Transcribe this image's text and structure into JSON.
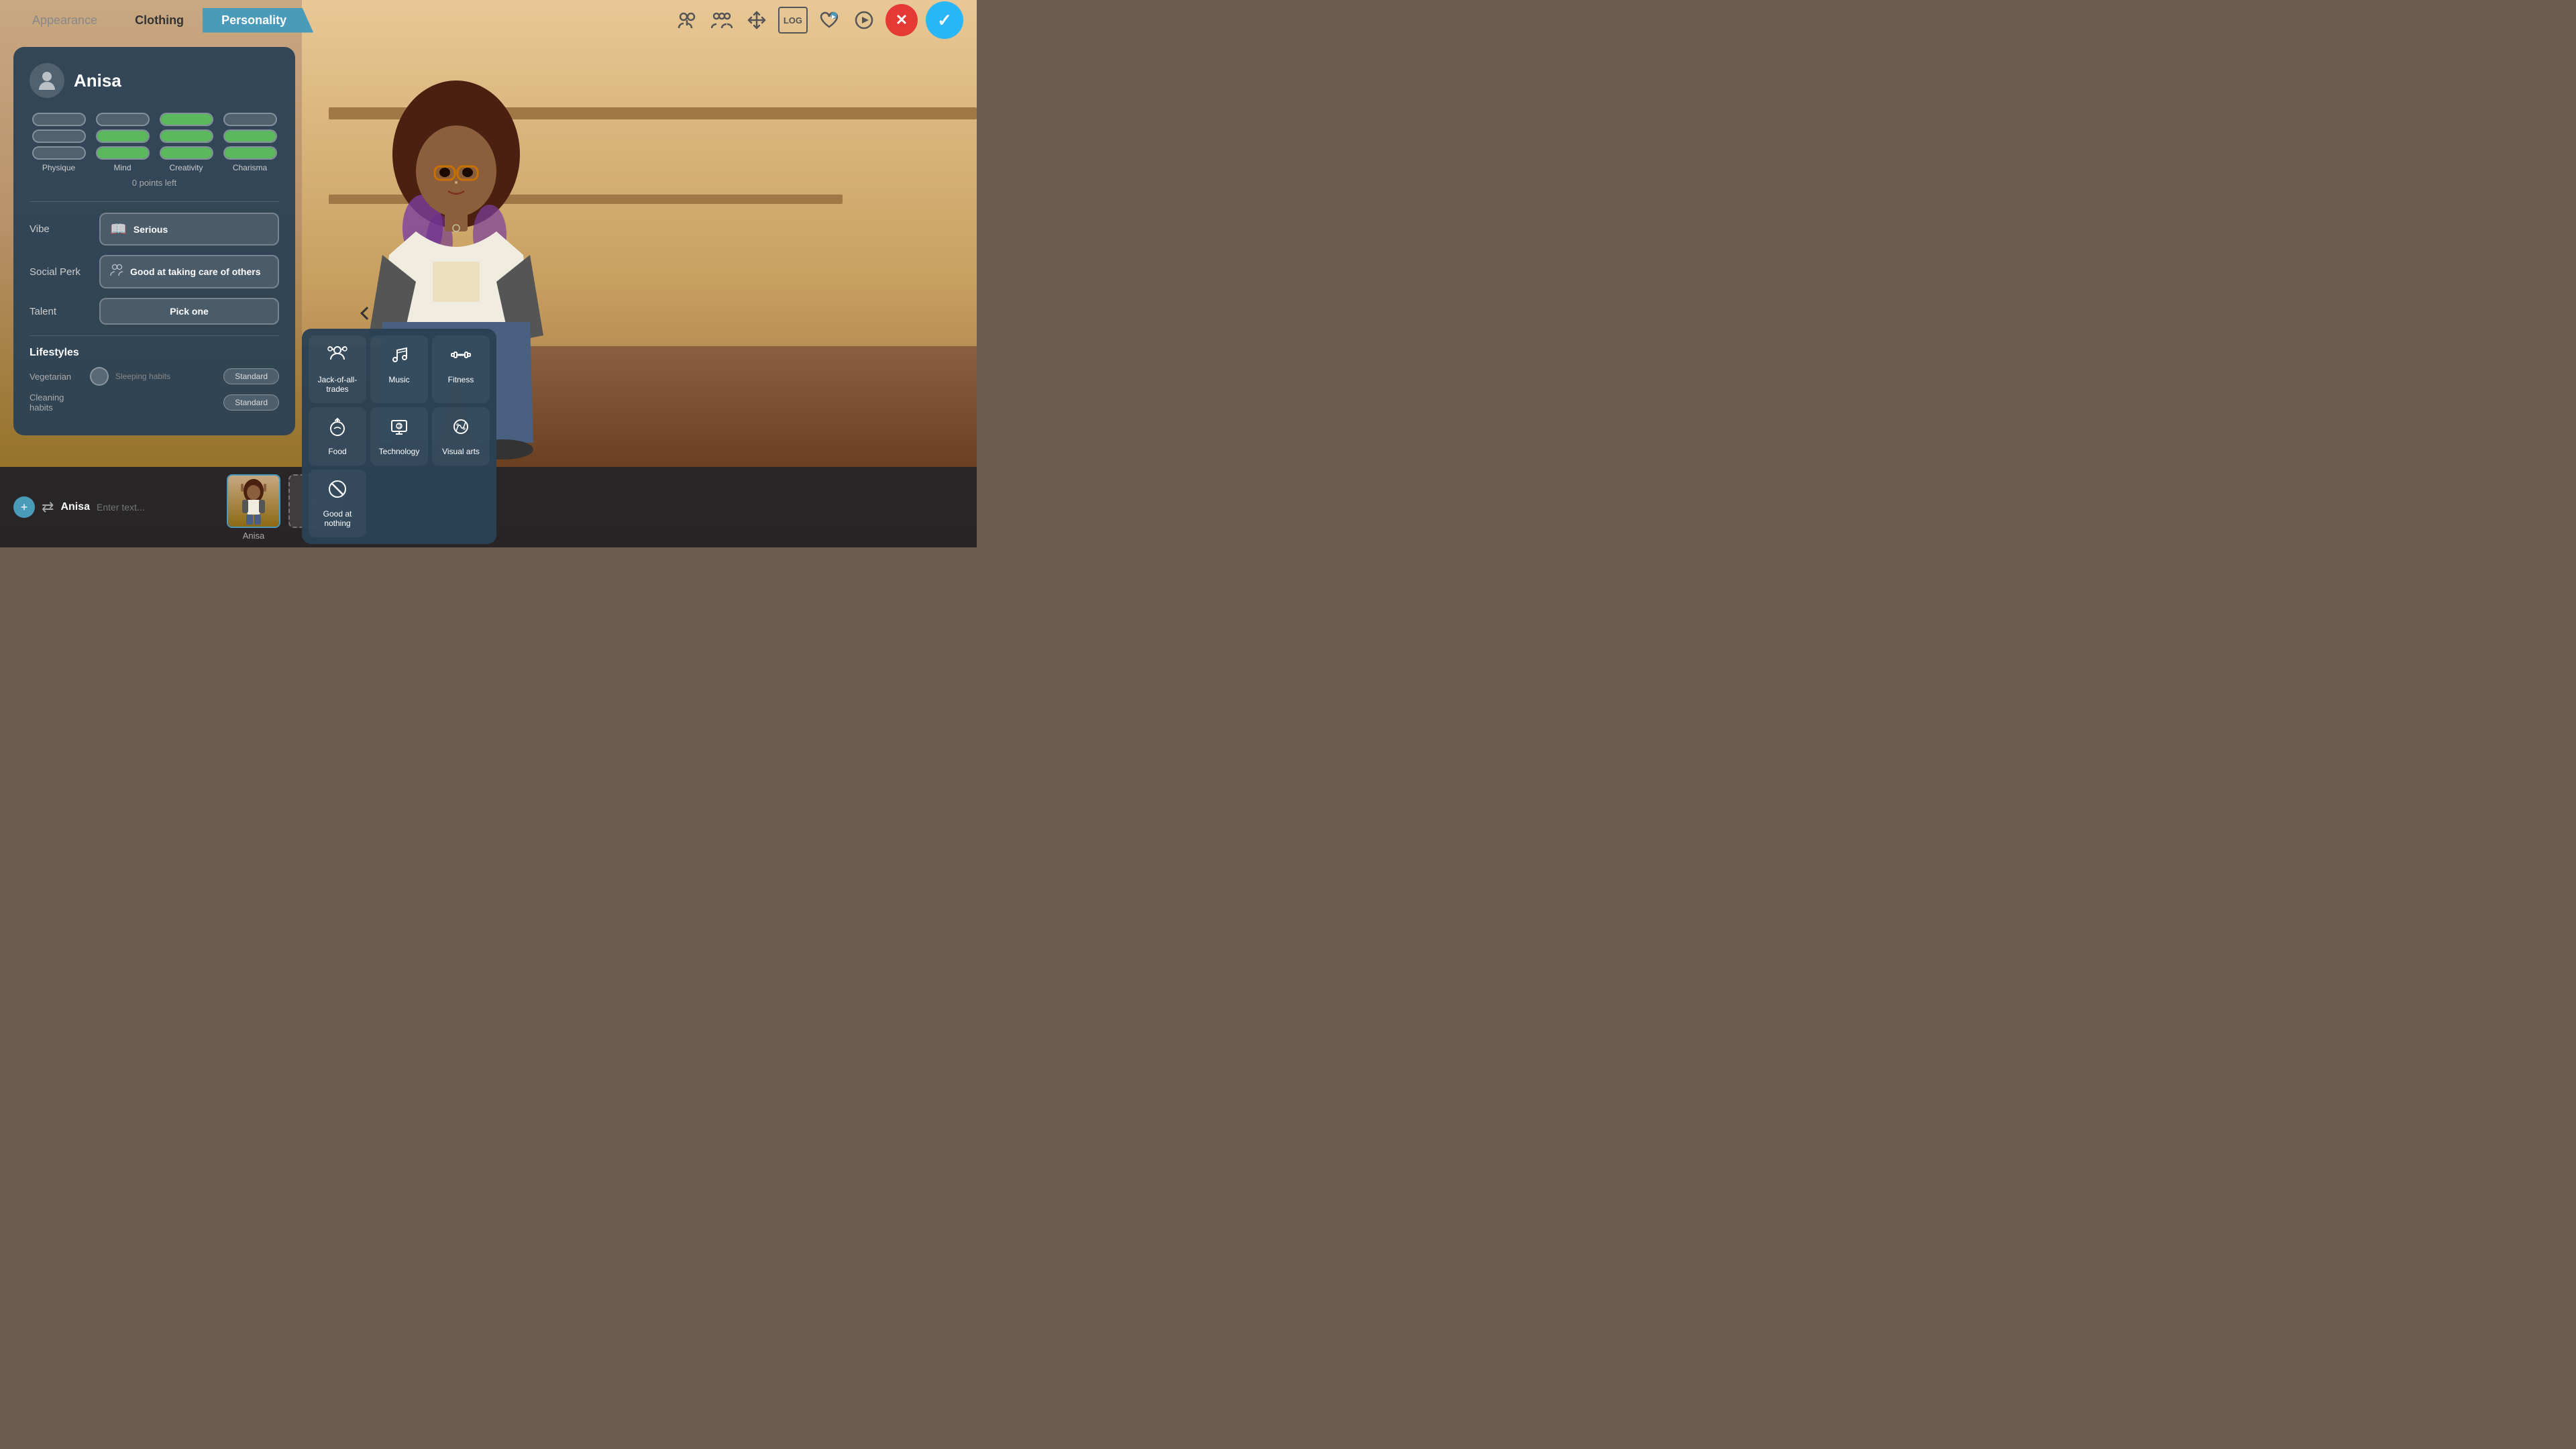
{
  "nav": {
    "tabs": [
      {
        "id": "appearance",
        "label": "Appearance",
        "active": false
      },
      {
        "id": "clothing",
        "label": "Clothing",
        "active": false
      },
      {
        "id": "personality",
        "label": "Personality",
        "active": true
      }
    ],
    "icons": [
      {
        "id": "relationships",
        "symbol": "👥",
        "label": "Relationships"
      },
      {
        "id": "group",
        "symbol": "👨‍👩‍👧‍👦",
        "label": "Group"
      },
      {
        "id": "arrow",
        "symbol": "🔀",
        "label": "Move"
      },
      {
        "id": "log",
        "label": "LOG"
      },
      {
        "id": "heart",
        "symbol": "❤️",
        "label": "Heart"
      },
      {
        "id": "play",
        "symbol": "▶",
        "label": "Play"
      }
    ],
    "cancel_label": "✕",
    "confirm_label": "✓"
  },
  "panel": {
    "character_name": "Anisa",
    "stats": {
      "points_left": "0 points left",
      "columns": [
        {
          "label": "Physique",
          "bars": [
            {
              "fill": "empty"
            },
            {
              "fill": "empty"
            },
            {
              "fill": "empty"
            }
          ]
        },
        {
          "label": "Mind",
          "bars": [
            {
              "fill": "empty"
            },
            {
              "fill": "full"
            },
            {
              "fill": "full"
            }
          ]
        },
        {
          "label": "Creativity",
          "bars": [
            {
              "fill": "full"
            },
            {
              "fill": "full"
            },
            {
              "fill": "full"
            }
          ]
        },
        {
          "label": "Charisma",
          "bars": [
            {
              "fill": "empty"
            },
            {
              "fill": "full"
            },
            {
              "fill": "full"
            }
          ]
        }
      ]
    },
    "traits": {
      "vibe": {
        "label": "Vibe",
        "value": "Serious",
        "icon": "📖"
      },
      "social_perk": {
        "label": "Social Perk",
        "value": "Good at taking care of others",
        "icon": "👥"
      },
      "talent": {
        "label": "Talent",
        "value": "Pick one",
        "icon": ""
      }
    },
    "lifestyles": {
      "title": "Lifestyles",
      "items": [
        {
          "label": "Vegetarian",
          "sublabel": "Sleeping habits",
          "badge": "Standard"
        },
        {
          "label": "Cleaning habits",
          "badge": "Standard"
        }
      ]
    }
  },
  "talent_dropdown": {
    "items": [
      {
        "id": "jack",
        "label": "Jack-of-all-trades",
        "icon": "✨"
      },
      {
        "id": "music",
        "label": "Music",
        "icon": "🎵"
      },
      {
        "id": "fitness",
        "label": "Fitness",
        "icon": "🏋️"
      },
      {
        "id": "food",
        "label": "Food",
        "icon": "🍳"
      },
      {
        "id": "technology",
        "label": "Technology",
        "icon": "💻"
      },
      {
        "id": "visual_arts",
        "label": "Visual arts",
        "icon": "🎨"
      },
      {
        "id": "nothing",
        "label": "Good at nothing",
        "icon": "🚫"
      }
    ]
  },
  "bottom_bar": {
    "character_name": "Anisa",
    "chat_placeholder": "Enter text...",
    "add_button": "+"
  }
}
